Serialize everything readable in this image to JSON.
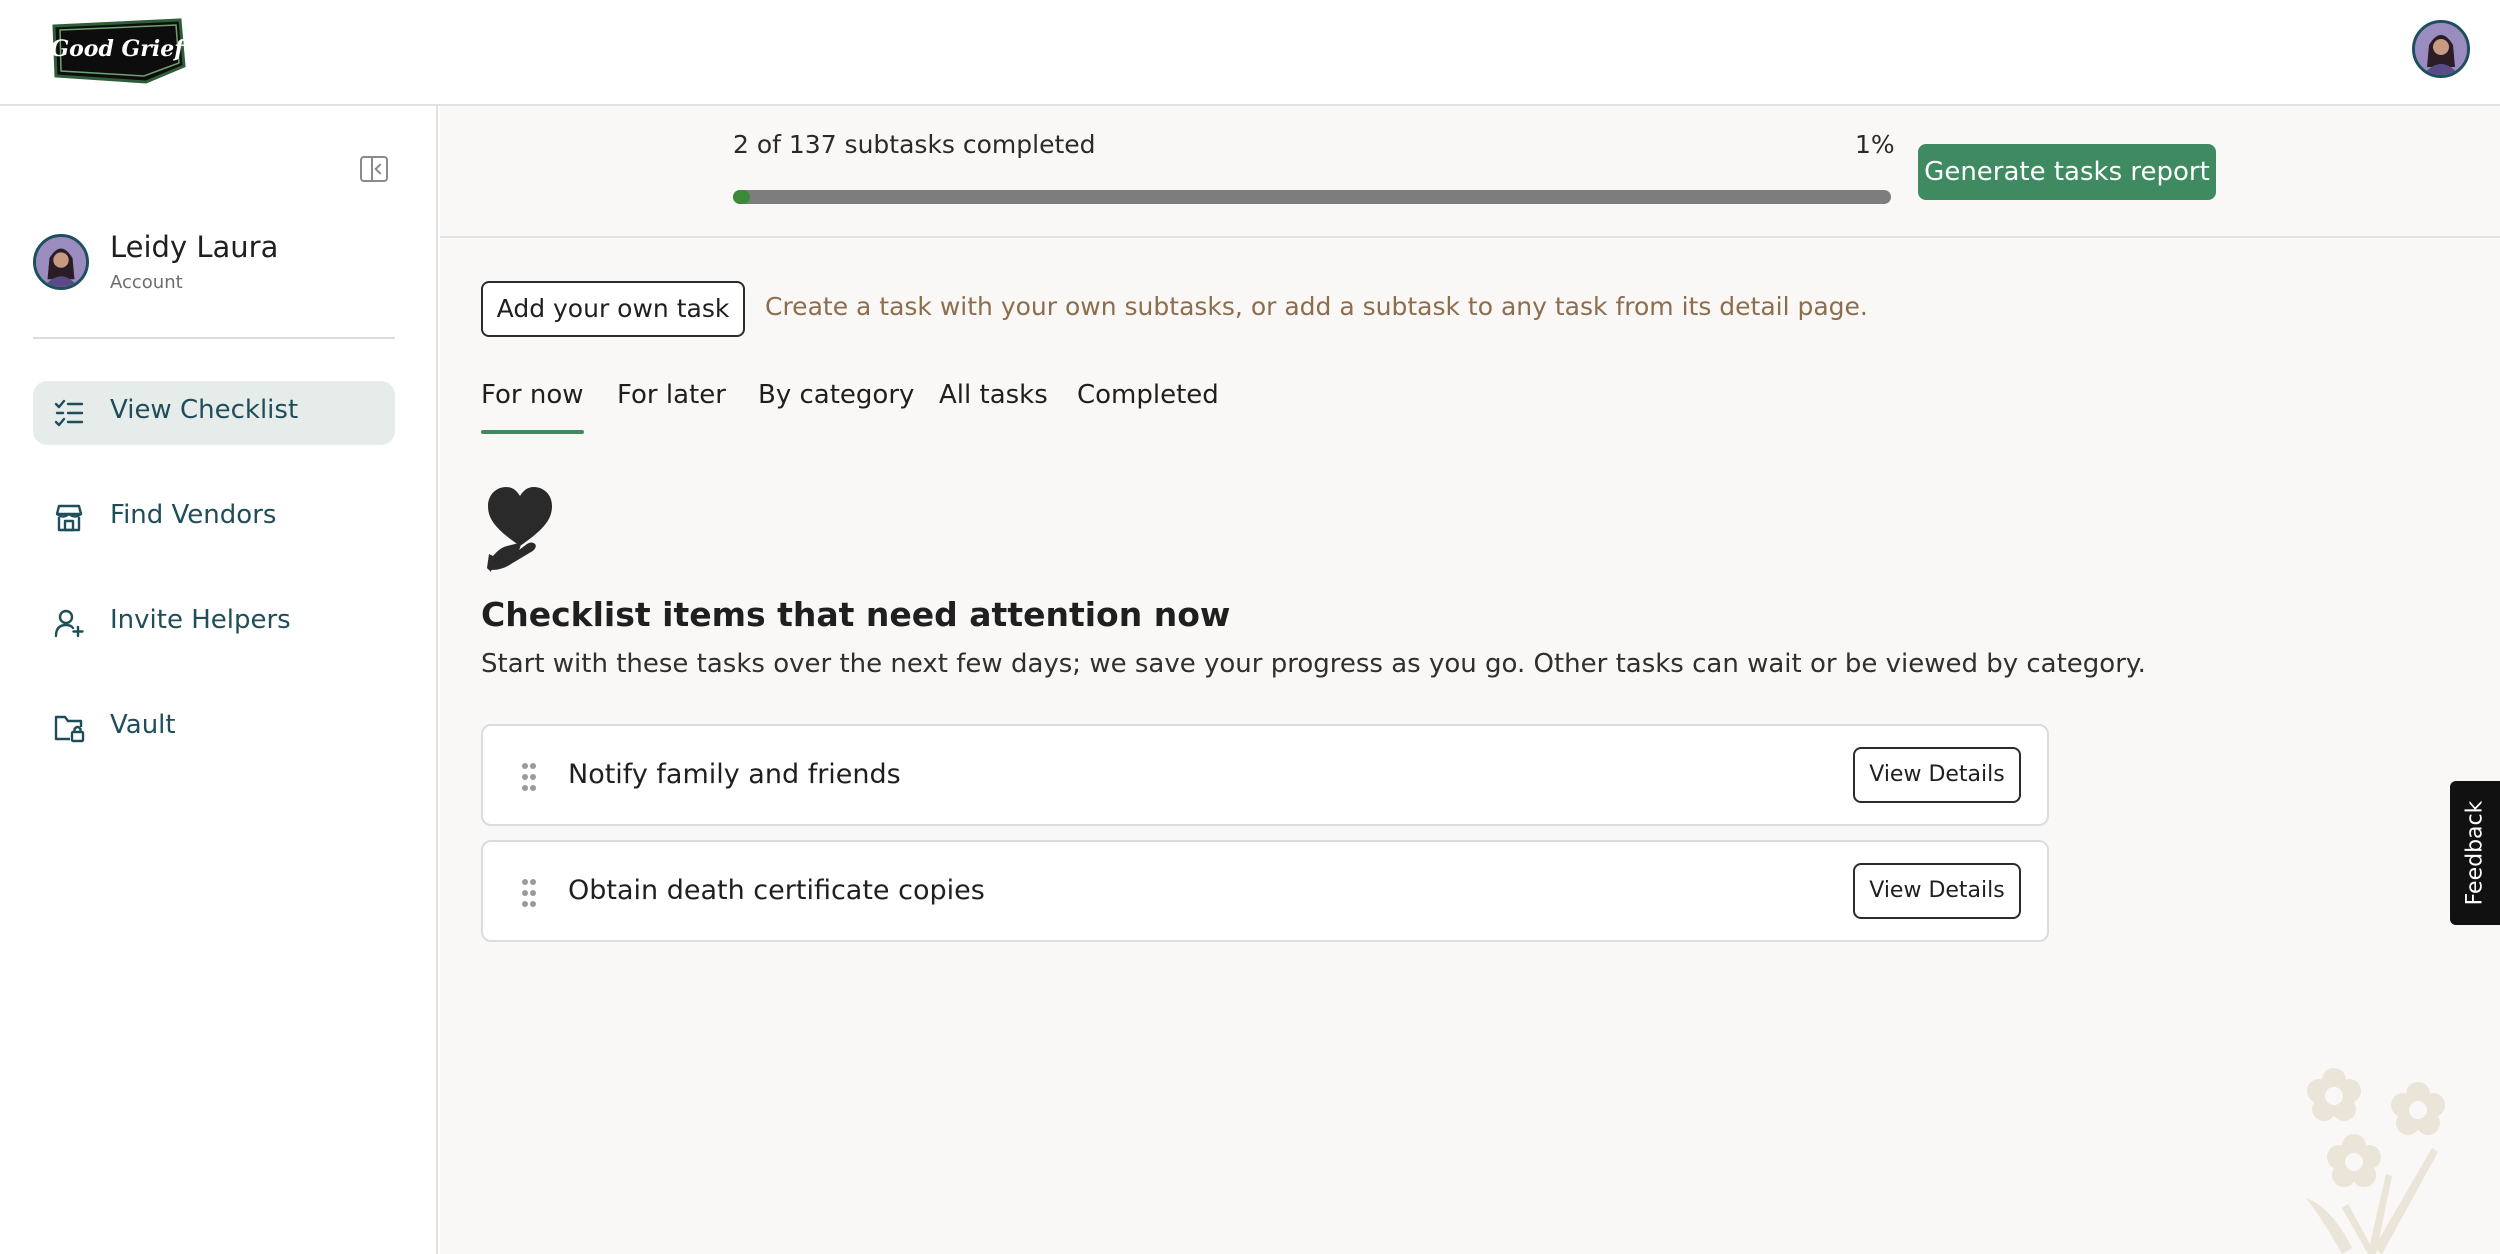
{
  "header": {
    "logo_text": "Good Grief",
    "logo_icon": "good-grief-logo",
    "avatar_icon": "user-avatar"
  },
  "sidebar": {
    "collapse_icon": "sidebar-collapse-icon",
    "profile": {
      "name": "Leidy Laura",
      "subtitle": "Account"
    },
    "items": [
      {
        "label": "View Checklist",
        "icon": "checklist-icon",
        "active": true
      },
      {
        "label": "Find Vendors",
        "icon": "storefront-icon",
        "active": false
      },
      {
        "label": "Invite Helpers",
        "icon": "user-plus-icon",
        "active": false
      },
      {
        "label": "Vault",
        "icon": "folder-lock-icon",
        "active": false
      }
    ]
  },
  "progress": {
    "text": "2 of 137 subtasks completed",
    "percent_label": "1%",
    "completed": 2,
    "total": 137,
    "generate_label": "Generate tasks report"
  },
  "add_task": {
    "button_label": "Add your own task",
    "hint": "Create a task with your own subtasks, or add a subtask to any task from its detail page."
  },
  "tabs": [
    {
      "label": "For now",
      "active": true
    },
    {
      "label": "For later",
      "active": false
    },
    {
      "label": "By category",
      "active": false
    },
    {
      "label": "All tasks",
      "active": false
    },
    {
      "label": "Completed",
      "active": false
    }
  ],
  "section": {
    "icon": "heart-hand-icon",
    "title": "Checklist items that need attention now",
    "description": "Start with these tasks over the next few days; we save your progress as you go. Other tasks can wait or be viewed by category."
  },
  "tasks": [
    {
      "label": "Notify family and friends",
      "button": "View Details"
    },
    {
      "label": "Obtain death certificate copies",
      "button": "View Details"
    }
  ],
  "feedback_label": "Feedback",
  "colors": {
    "accent_green": "#3f8a61",
    "progress_fill": "#3b8a3a",
    "nav_text": "#1f4e5a",
    "hint_text": "#8e6d4c",
    "main_background": "#f9f8f6"
  }
}
